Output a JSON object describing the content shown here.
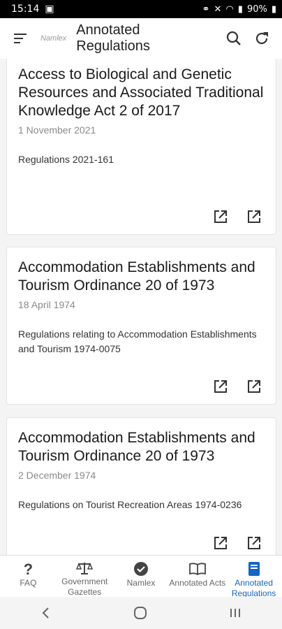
{
  "status": {
    "time": "15:14",
    "battery": "90%"
  },
  "header": {
    "title": "Annotated Regulations",
    "logo_text": "Namlex"
  },
  "cards": [
    {
      "title": "Access to Biological and Genetic Resources and Associated Traditional Knowledge Act 2 of 2017",
      "date": "1 November 2021",
      "regulation": "Regulations 2021-161"
    },
    {
      "title": "Accommodation Establishments and Tourism Ordinance 20 of 1973",
      "date": "18 April 1974",
      "regulation": "Regulations relating to Accommodation Establishments and Tourism 1974-0075"
    },
    {
      "title": "Accommodation Establishments and Tourism Ordinance 20 of 1973",
      "date": "2 December 1974",
      "regulation": "Regulations on Tourist Recreation Areas 1974-0236"
    }
  ],
  "nav": {
    "faq": "FAQ",
    "gazettes": "Government Gazettes",
    "namlex": "Namlex",
    "acts": "Annotated Acts",
    "regulations": "Annotated Regulations"
  },
  "colors": {
    "accent": "#1565c0"
  }
}
